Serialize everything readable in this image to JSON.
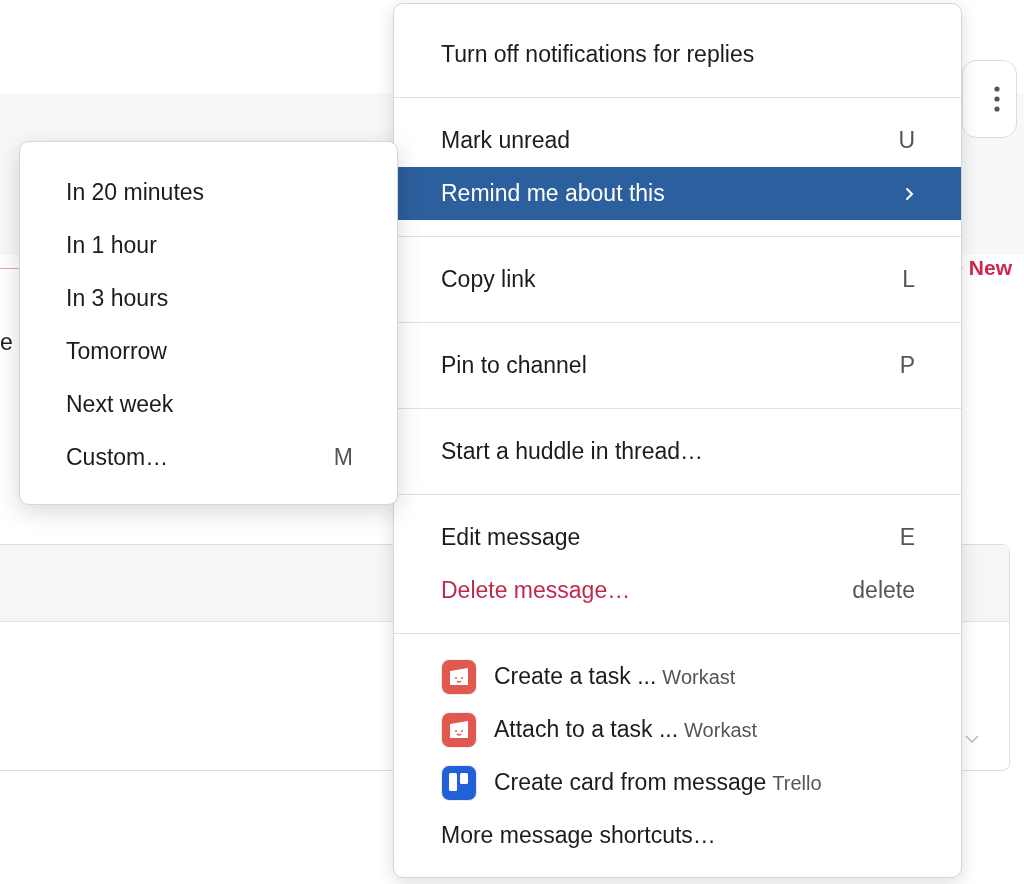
{
  "background": {
    "partial_text": "e",
    "new_label": "New"
  },
  "menu": {
    "sections": [
      {
        "items": [
          {
            "kind": "plain",
            "label": "Turn off notifications for replies",
            "selected": false
          }
        ]
      },
      {
        "items": [
          {
            "kind": "plain",
            "label": "Mark unread",
            "shortcut": "U",
            "selected": false
          },
          {
            "kind": "submenu",
            "label": "Remind me about this",
            "selected": true
          }
        ]
      },
      {
        "items": [
          {
            "kind": "plain",
            "label": "Copy link",
            "shortcut": "L",
            "selected": false
          }
        ]
      },
      {
        "items": [
          {
            "kind": "plain",
            "label": "Pin to channel",
            "shortcut": "P",
            "selected": false
          }
        ]
      },
      {
        "items": [
          {
            "kind": "plain",
            "label": "Start a huddle in thread…",
            "selected": false
          }
        ]
      },
      {
        "items": [
          {
            "kind": "plain",
            "label": "Edit message",
            "shortcut": "E",
            "selected": false
          },
          {
            "kind": "danger",
            "label": "Delete message…",
            "shortcut": "delete",
            "selected": false
          }
        ]
      },
      {
        "items": [
          {
            "kind": "app-face",
            "label": "Create a task ...",
            "app_name": "Workast",
            "color": "#e0584f",
            "selected": false
          },
          {
            "kind": "app-face",
            "label": "Attach to a task ...",
            "app_name": "Workast",
            "color": "#e0584f",
            "selected": false
          },
          {
            "kind": "app-board",
            "label": "Create card from message",
            "app_name": "Trello",
            "color": "#2160d6",
            "selected": false
          },
          {
            "kind": "plain",
            "label": "More message shortcuts…",
            "selected": false
          }
        ]
      }
    ]
  },
  "submenu": {
    "items": [
      {
        "label": "In 20 minutes",
        "selected": false
      },
      {
        "label": "In 1 hour",
        "selected": false
      },
      {
        "label": "In 3 hours",
        "selected": false
      },
      {
        "label": "Tomorrow",
        "selected": false
      },
      {
        "label": "Next week",
        "selected": false
      },
      {
        "label": "Custom…",
        "shortcut": "M",
        "selected": false
      }
    ]
  }
}
